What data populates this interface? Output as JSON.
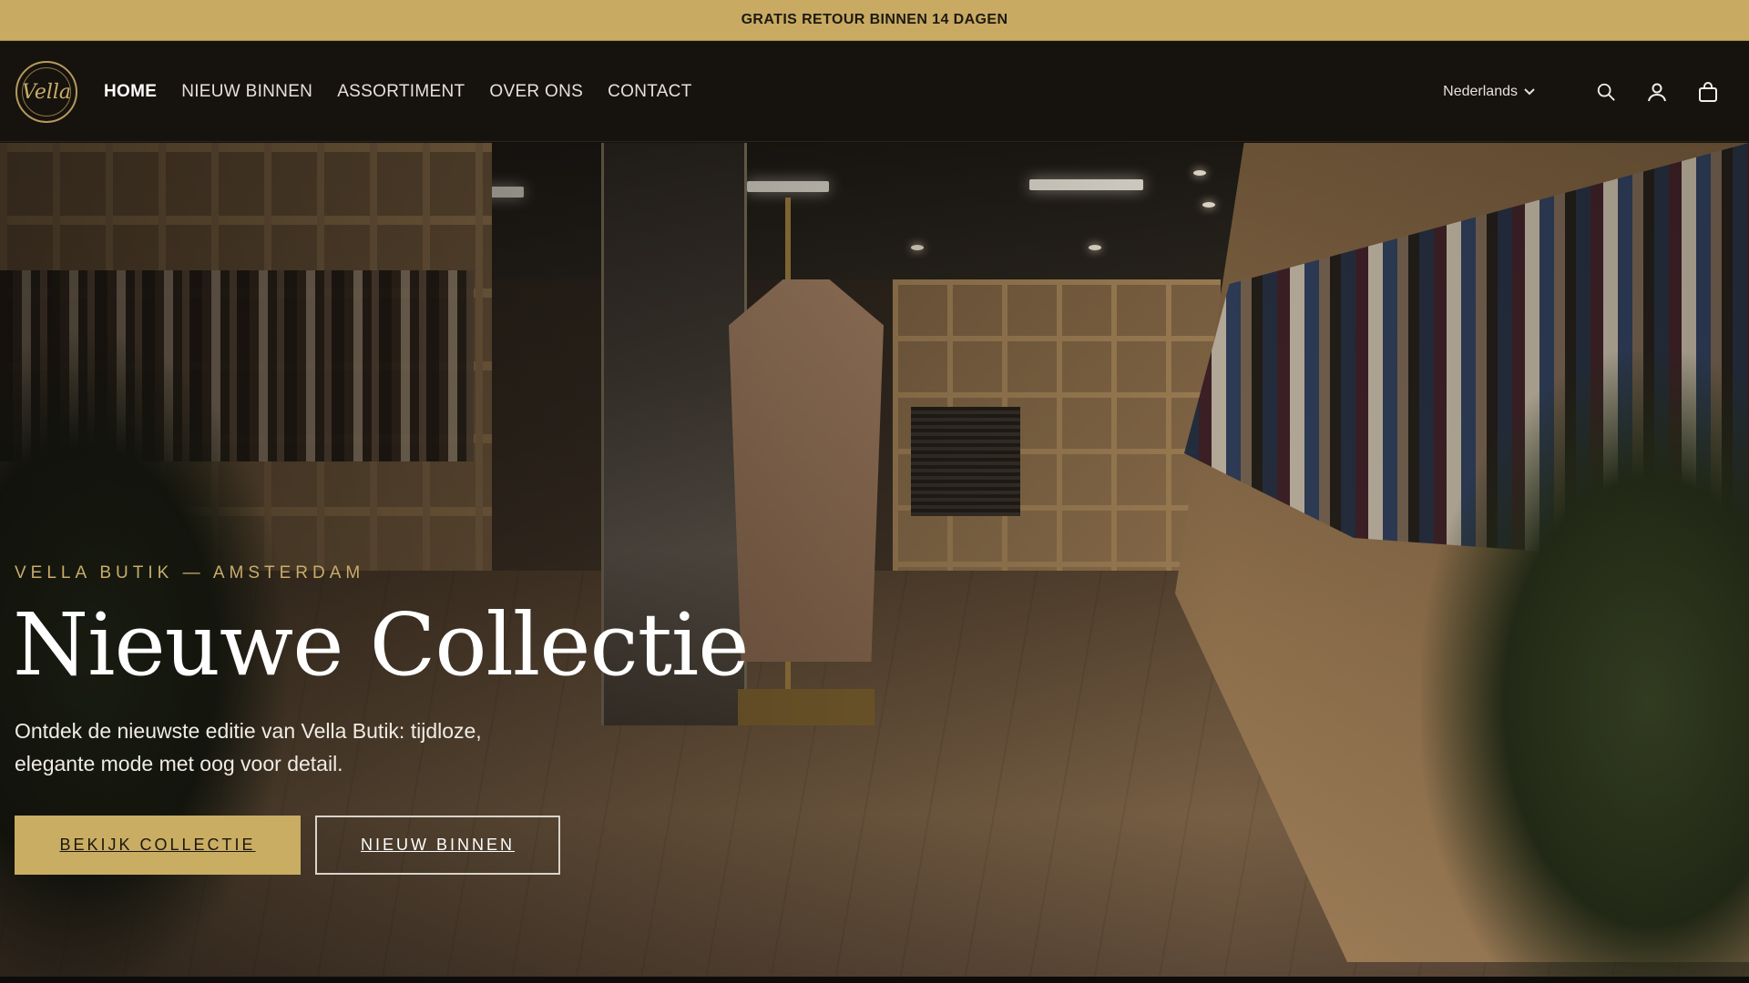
{
  "announcement": {
    "text": "GRATIS RETOUR BINNEN 14 DAGEN"
  },
  "header": {
    "logo_text": "Vella",
    "nav": [
      {
        "label": "HOME",
        "active": true
      },
      {
        "label": "NIEUW BINNEN",
        "active": false
      },
      {
        "label": "ASSORTIMENT",
        "active": false
      },
      {
        "label": "OVER ONS",
        "active": false
      },
      {
        "label": "CONTACT",
        "active": false
      }
    ],
    "language": "Nederlands",
    "icons": [
      "chevron-down-icon",
      "search-icon",
      "account-icon",
      "cart-icon"
    ]
  },
  "hero": {
    "eyebrow": "VELLA BUTIK — AMSTERDAM",
    "title": "Nieuwe Collectie",
    "subtitle": "Ontdek de nieuwste editie van Vella Butik: tijdloze, elegante mode met oog voor detail.",
    "primary_button": "BEKIJK COLLECTIE",
    "secondary_button": "NIEUW BINNEN"
  },
  "colors": {
    "accent": "#c9ad62",
    "header_bg": "#16120e",
    "announcement_bg": "#c8aa62"
  }
}
